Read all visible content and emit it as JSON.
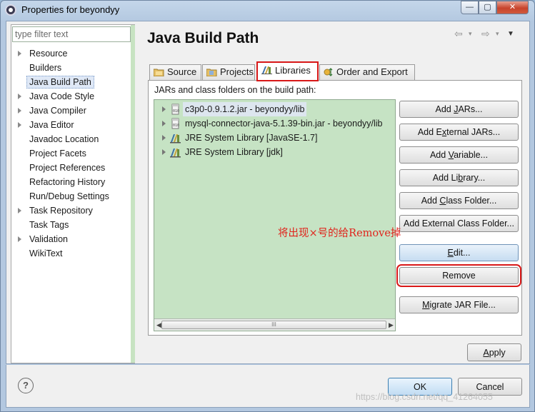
{
  "window": {
    "title": "Properties for beyondyy",
    "controls": {
      "minimize": "—",
      "maximize": "▢",
      "close": "✕"
    }
  },
  "sidebar": {
    "filter_placeholder": "type filter text",
    "items": [
      {
        "label": "Resource",
        "expandable": true
      },
      {
        "label": "Builders",
        "expandable": false
      },
      {
        "label": "Java Build Path",
        "expandable": false,
        "selected": true
      },
      {
        "label": "Java Code Style",
        "expandable": true
      },
      {
        "label": "Java Compiler",
        "expandable": true
      },
      {
        "label": "Java Editor",
        "expandable": true
      },
      {
        "label": "Javadoc Location",
        "expandable": false
      },
      {
        "label": "Project Facets",
        "expandable": false
      },
      {
        "label": "Project References",
        "expandable": false
      },
      {
        "label": "Refactoring History",
        "expandable": false
      },
      {
        "label": "Run/Debug Settings",
        "expandable": false
      },
      {
        "label": "Task Repository",
        "expandable": true
      },
      {
        "label": "Task Tags",
        "expandable": false
      },
      {
        "label": "Validation",
        "expandable": true
      },
      {
        "label": "WikiText",
        "expandable": false
      }
    ]
  },
  "main": {
    "title": "Java Build Path",
    "tabs": [
      {
        "label": "Source"
      },
      {
        "label": "Projects"
      },
      {
        "label": "Libraries",
        "active": true
      },
      {
        "label": "Order and Export"
      }
    ],
    "panel_label": "JARs and class folders on the build path:",
    "libraries": [
      {
        "label": "c3p0-0.9.1.2.jar - beyondyy/lib",
        "icon": "jar-icon",
        "selected": true
      },
      {
        "label": "mysql-connector-java-5.1.39-bin.jar - beyondyy/lib",
        "icon": "jar-icon"
      },
      {
        "label": "JRE System Library [JavaSE-1.7]",
        "icon": "library-icon"
      },
      {
        "label": "JRE System Library [jdk]",
        "icon": "library-icon"
      }
    ],
    "scroll_grip": "III",
    "buttons": {
      "add_jars": {
        "pre": "Add ",
        "acc": "J",
        "post": "ARs..."
      },
      "add_external_jars": {
        "pre": "Add E",
        "acc": "x",
        "post": "ternal JARs..."
      },
      "add_variable": {
        "pre": "Add ",
        "acc": "V",
        "post": "ariable..."
      },
      "add_library": {
        "pre": "Add Li",
        "acc": "b",
        "post": "rary..."
      },
      "add_class_folder": {
        "pre": "Add ",
        "acc": "C",
        "post": "lass Folder..."
      },
      "add_external_class_folder": {
        "pre": "Add External Class Folder...",
        "acc": "",
        "post": ""
      },
      "edit": {
        "pre": "",
        "acc": "E",
        "post": "dit..."
      },
      "remove": {
        "pre": "Remove",
        "acc": "",
        "post": ""
      },
      "migrate_jar": {
        "pre": "",
        "acc": "M",
        "post": "igrate JAR File..."
      }
    },
    "annotation": "将出现×号的给Remove掉",
    "apply": {
      "pre": "",
      "acc": "A",
      "post": "pply"
    }
  },
  "footer": {
    "help": "?",
    "ok": "OK",
    "cancel": "Cancel"
  },
  "watermark": "https://blog.csdn.net/qq_41264055",
  "colors": {
    "highlight_red": "#d81818",
    "list_background": "#c6e3c4",
    "annotation_red": "#e0241c"
  }
}
